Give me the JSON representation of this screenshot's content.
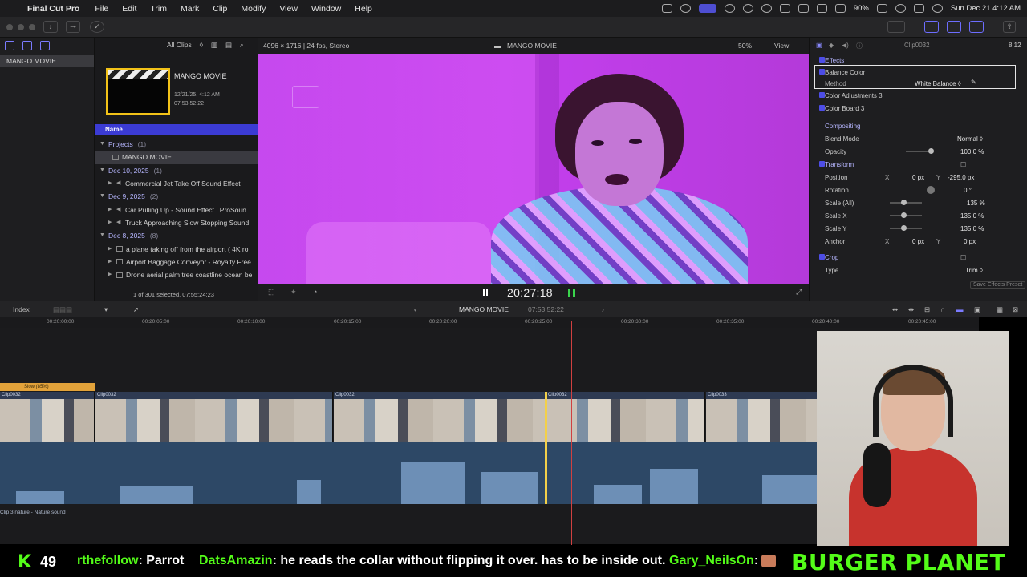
{
  "menubar": {
    "app": "Final Cut Pro",
    "items": [
      "File",
      "Edit",
      "Trim",
      "Mark",
      "Clip",
      "Modify",
      "View",
      "Window",
      "Help"
    ],
    "battery": "90%",
    "datetime": "Sun Dec 21  4:12 AM"
  },
  "library": {
    "name": "MANGO MOVIE"
  },
  "browser": {
    "filter": "All Clips",
    "card_title": "MANGO MOVIE",
    "card_date": "12/21/25, 4:12 AM",
    "card_duration": "07:53:52:22",
    "name_header": "Name",
    "projects_label": "Projects",
    "projects_count": "(1)",
    "project_item": "MANGO MOVIE",
    "sections": [
      {
        "label": "Dec 10, 2025",
        "count": "(1)",
        "items": [
          "Commercial Jet Take Off Sound Effect"
        ]
      },
      {
        "label": "Dec 9, 2025",
        "count": "(2)",
        "items": [
          "Car Pulling Up - Sound Effect  |  ProSoun",
          "Truck Approaching Slow Stopping Sound"
        ]
      },
      {
        "label": "Dec 8, 2025",
        "count": "(8)",
        "items": [
          "a plane taking off from the airport ( 4K ro",
          "Airport Baggage Conveyor - Royalty Free",
          "Drone aerial palm tree coastline ocean be"
        ]
      }
    ],
    "footer": "1 of 301 selected, 07:55:24:23"
  },
  "viewer": {
    "format": "4096 × 1716 | 24 fps, Stereo",
    "title": "MANGO MOVIE",
    "zoom": "50%",
    "view": "View",
    "timecode": "20:27:18"
  },
  "inspector": {
    "clip": "Clip0032",
    "duration": "8:12",
    "effects_label": "Effects",
    "balance_color": "Balance Color",
    "method_label": "Method",
    "method_value": "White Balance ◊",
    "color_adjustments": "Color Adjustments 3",
    "color_board": "Color Board 3",
    "compositing": "Compositing",
    "blend_mode": "Blend Mode",
    "blend_value": "Normal ◊",
    "opacity": "Opacity",
    "opacity_value": "100.0 %",
    "transform": "Transform",
    "position": "Position",
    "pos_x_axis": "X",
    "pos_x": "0 px",
    "pos_y_axis": "Y",
    "pos_y": "-295.0 px",
    "rotation": "Rotation",
    "rotation_value": "0 °",
    "scale_all": "Scale (All)",
    "scale_all_value": "135 %",
    "scale_x": "Scale X",
    "scale_x_value": "135.0 %",
    "scale_y": "Scale Y",
    "scale_y_value": "135.0 %",
    "anchor": "Anchor",
    "anchor_x_axis": "X",
    "anchor_x": "0 px",
    "anchor_y_axis": "Y",
    "anchor_y": "0 px",
    "crop": "Crop",
    "type_label": "Type",
    "type_value": "Trim ◊",
    "save_preset": "Save Effects Preset"
  },
  "timeline": {
    "index": "Index",
    "project": "MANGO MOVIE",
    "duration": "07:53:52:22",
    "ticks": [
      "00:20:00:00",
      "00:20:05:00",
      "00:20:10:00",
      "00:20:15:00",
      "00:20:20:00",
      "00:20:25:00",
      "00:20:30:00",
      "00:20:35:00",
      "00:20:40:00",
      "00:20:45:00"
    ],
    "retime_label": "Slow (85%)",
    "clips": [
      "Clip0032",
      "Clip0032",
      "Clip0032",
      "Clip0032",
      "Clip0033"
    ],
    "audio_label": "Clip 3 nature - Nature sound"
  },
  "stream": {
    "viewer_count": "49",
    "chat": [
      {
        "user": "rthefollow",
        "message": ": Parrot"
      },
      {
        "user": "DatsAmazin",
        "message": ": he reads the collar without flipping it over. has to be inside out."
      },
      {
        "user": "Gary_NeilsOn",
        "message": ":"
      }
    ],
    "brand": "BURGER PLANET"
  }
}
